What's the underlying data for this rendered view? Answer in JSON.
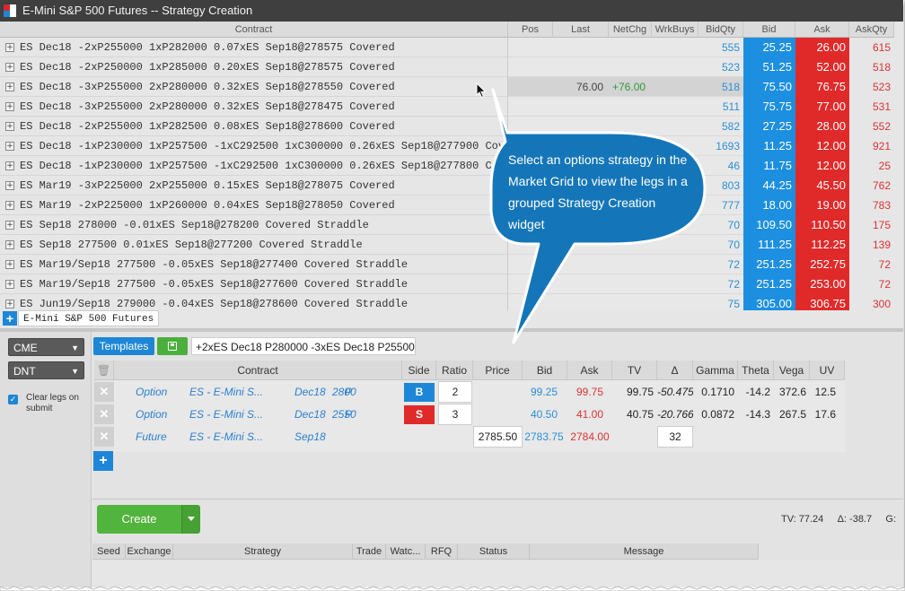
{
  "window": {
    "title": "E-Mini S&P 500 Futures -- Strategy Creation",
    "logo_colors": [
      "#d9262b",
      "#ffffff",
      "#1d86d6",
      "#ffffff"
    ]
  },
  "market_grid": {
    "columns": {
      "contract": "Contract",
      "pos": "Pos",
      "last": "Last",
      "netchg": "NetChg",
      "wrkbuys": "WrkBuys",
      "bidqty": "BidQty",
      "bid": "Bid",
      "ask": "Ask",
      "askqty": "AskQty"
    },
    "rows": [
      {
        "contract": "ES Dec18 -2xP255000 1xP282000 0.07xES Sep18@278575 Covered",
        "last": "",
        "netchg": "",
        "bidqty": "555",
        "bid": "25.25",
        "ask": "26.00",
        "askqty": "615"
      },
      {
        "contract": "ES Dec18 -2xP250000 1xP285000 0.20xES Sep18@278575 Covered",
        "last": "",
        "netchg": "",
        "bidqty": "523",
        "bid": "51.25",
        "ask": "52.00",
        "askqty": "518"
      },
      {
        "contract": "ES Dec18 -3xP255000 2xP280000 0.32xES Sep18@278550 Covered",
        "last": "76.00",
        "netchg": "+76.00",
        "bidqty": "518",
        "bid": "75.50",
        "ask": "76.75",
        "askqty": "523"
      },
      {
        "contract": "ES Dec18 -3xP255000 2xP280000 0.32xES Sep18@278475 Covered",
        "last": "",
        "netchg": "",
        "bidqty": "511",
        "bid": "75.75",
        "ask": "77.00",
        "askqty": "531"
      },
      {
        "contract": "ES Dec18 -2xP255000 1xP282500 0.08xES Sep18@278600 Covered",
        "last": "",
        "netchg": "",
        "bidqty": "582",
        "bid": "27.25",
        "ask": "28.00",
        "askqty": "552"
      },
      {
        "contract": "ES Dec18 -1xP230000 1xP257500 -1xC292500 1xC300000 0.26xES Sep18@277900 Covered",
        "last": "",
        "netchg": "",
        "bidqty": "1693",
        "bid": "11.25",
        "ask": "12.00",
        "askqty": "921"
      },
      {
        "contract": "ES Dec18 -1xP230000 1xP257500 -1xC292500 1xC300000 0.26xES Sep18@277800 Covered",
        "last": "",
        "netchg": "",
        "bidqty": "46",
        "bid": "11.75",
        "ask": "12.00",
        "askqty": "25"
      },
      {
        "contract": "ES Mar19 -3xP225000 2xP255000 0.15xES Sep18@278075 Covered",
        "last": "",
        "netchg": "",
        "bidqty": "803",
        "bid": "44.25",
        "ask": "45.50",
        "askqty": "762"
      },
      {
        "contract": "ES Mar19 -2xP225000 1xP260000 0.04xES Sep18@278050 Covered",
        "last": "",
        "netchg": "",
        "bidqty": "777",
        "bid": "18.00",
        "ask": "19.00",
        "askqty": "783"
      },
      {
        "contract": "ES Sep18 278000 -0.01xES Sep18@278200 Covered Straddle",
        "last": "",
        "netchg": "",
        "bidqty": "70",
        "bid": "109.50",
        "ask": "110.50",
        "askqty": "175"
      },
      {
        "contract": "ES Sep18 277500 0.01xES Sep18@277200 Covered Straddle",
        "last": "",
        "netchg": "",
        "bidqty": "70",
        "bid": "111.25",
        "ask": "112.25",
        "askqty": "139"
      },
      {
        "contract": "ES Mar19/Sep18 277500 -0.05xES Sep18@277400 Covered Straddle",
        "last": "",
        "netchg": "",
        "bidqty": "72",
        "bid": "251.25",
        "ask": "252.75",
        "askqty": "72"
      },
      {
        "contract": "ES Mar19/Sep18 277500 -0.05xES Sep18@277600 Covered Straddle",
        "last": "",
        "netchg": "",
        "bidqty": "72",
        "bid": "251.25",
        "ask": "253.00",
        "askqty": "72"
      },
      {
        "contract": "ES Jun19/Sep18 279000 -0.04xES Sep18@278600 Covered Straddle",
        "last": "",
        "netchg": "",
        "bidqty": "75",
        "bid": "305.00",
        "ask": "306.75",
        "askqty": "300"
      }
    ],
    "highlighted_row": 2,
    "tab_add_icon": "plus-icon",
    "tab_label": "E-Mini S&P 500 Futures"
  },
  "strategy_panel": {
    "exchange_select": "CME",
    "type_select": "DNT",
    "clear_legs_checked": true,
    "clear_legs_label": "Clear legs on submit",
    "templates_label": "Templates",
    "save_icon": "save-icon",
    "strategy_name": "+2xES Dec18 P280000 -3xES Dec18 P25500",
    "legs_table": {
      "columns": {
        "contract": "Contract",
        "side": "Side",
        "ratio": "Ratio",
        "price": "Price",
        "bid": "Bid",
        "ask": "Ask",
        "tv": "TV",
        "delta": "Δ",
        "gamma": "Gamma",
        "theta": "Theta",
        "vega": "Vega",
        "uv": "UV"
      },
      "legs": [
        {
          "type": "Option",
          "product": "ES - E-Mini S...",
          "expiry": "Dec18",
          "strike": "2800",
          "cp": "P",
          "side": "B",
          "side_color": "#1d86d6",
          "ratio": "2",
          "price": "",
          "bid": "99.25",
          "ask": "99.75",
          "tv": "99.75",
          "delta": "-50.475",
          "gamma": "0.1710",
          "theta": "-14.2",
          "vega": "372.6",
          "uv": "12.5"
        },
        {
          "type": "Option",
          "product": "ES - E-Mini S...",
          "expiry": "Dec18",
          "strike": "2550",
          "cp": "P",
          "side": "S",
          "side_color": "#e02a2a",
          "ratio": "3",
          "price": "",
          "bid": "40.50",
          "ask": "41.00",
          "tv": "40.75",
          "delta": "-20.766",
          "gamma": "0.0872",
          "theta": "-14.3",
          "vega": "267.5",
          "uv": "17.6"
        },
        {
          "type": "Future",
          "product": "ES - E-Mini S...",
          "expiry": "Sep18",
          "strike": "",
          "cp": "",
          "side": "",
          "side_color": "",
          "ratio": "",
          "price": "2785.50",
          "bid": "2783.75",
          "ask": "2784.00",
          "tv": "",
          "delta": "32",
          "gamma": "",
          "theta": "",
          "vega": "",
          "uv": ""
        }
      ],
      "remove_icon": "close-icon",
      "add_icon": "plus-icon"
    },
    "create_label": "Create",
    "summary": {
      "tv": "TV: 77.24",
      "delta": "Δ: -38.7",
      "gamma": "G:"
    },
    "orders_columns": [
      "Seed",
      "Exchange",
      "Strategy",
      "Trade",
      "Watc...",
      "RFQ",
      "Status",
      "Message"
    ]
  },
  "callout": {
    "text": "Select an options strategy in the Market Grid to view the legs in a grouped Strategy Creation widget",
    "color": "#1476b8"
  }
}
